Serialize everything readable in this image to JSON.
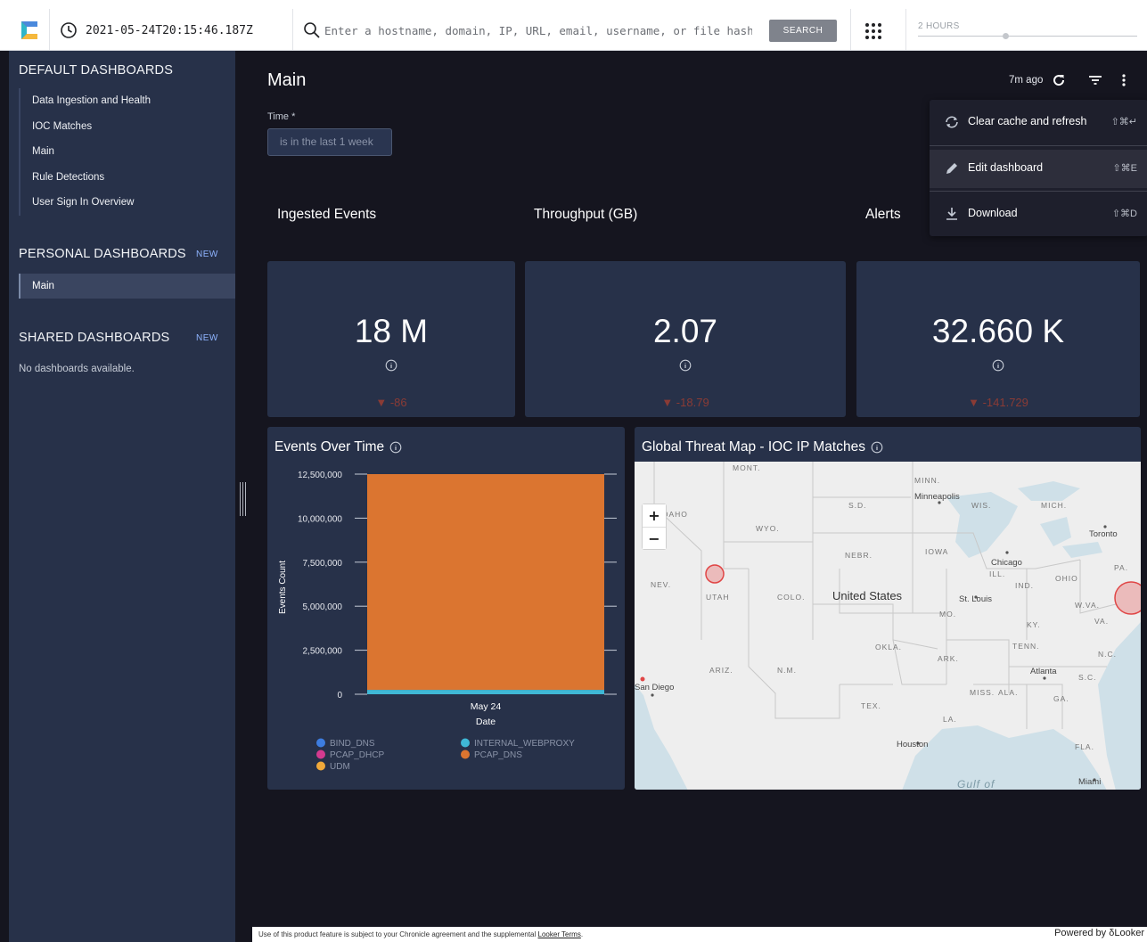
{
  "topbar": {
    "timestamp": "2021-05-24T20:15:46.187Z",
    "search_placeholder": "Enter a hostname, domain, IP, URL, email, username, or file hash",
    "search_button": "SEARCH",
    "time_range_label": "2 HOURS",
    "time_range_slider_fraction": 0.4
  },
  "sidebar": {
    "default_title": "DEFAULT DASHBOARDS",
    "default_items": [
      "Data Ingestion and Health",
      "IOC Matches",
      "Main",
      "Rule Detections",
      "User Sign In Overview"
    ],
    "personal_title": "PERSONAL DASHBOARDS",
    "personal_new": "NEW",
    "personal_items": [
      "Main"
    ],
    "shared_title": "SHARED DASHBOARDS",
    "shared_new": "NEW",
    "shared_empty": "No dashboards available."
  },
  "dashboard": {
    "title": "Main",
    "updated": "7m ago",
    "filter_label": "Time *",
    "filter_value": "is in the last 1 week"
  },
  "menu": {
    "items": [
      {
        "label": "Clear cache and refresh",
        "shortcut": "⇧⌘↵",
        "icon": "refresh-icon"
      },
      {
        "label": "Edit dashboard",
        "shortcut": "⇧⌘E",
        "icon": "pencil-icon"
      },
      {
        "label": "Download",
        "shortcut": "⇧⌘D",
        "icon": "download-icon"
      }
    ]
  },
  "tiles": [
    {
      "heading": "Ingested Events",
      "value": "18 M",
      "delta": "▼ -86"
    },
    {
      "heading": "Throughput (GB)",
      "value": "2.07",
      "delta": "▼ -18.79"
    },
    {
      "heading": "Alerts",
      "value": "32.660 K",
      "delta": "▼ -141.729"
    }
  ],
  "events_chart": {
    "title": "Events Over Time"
  },
  "map": {
    "title": "Global Threat Map - IOC IP Matches",
    "labels": [
      "MONT.",
      "MINN.",
      "Minneapolis",
      "WIS.",
      "MICH.",
      "IDAHO",
      "S.D.",
      "WYO.",
      "Toronto",
      "IOWA",
      "NEBR.",
      "Chicago",
      "PA.",
      "ILL.",
      "IND.",
      "OHIO",
      "NEV.",
      "UTAH",
      "COLO.",
      "United States",
      "St. Louis",
      "MO.",
      "W.VA.",
      "VA.",
      "KY.",
      "OKLA.",
      "TENN.",
      "N.C.",
      "ARK.",
      "ARIZ.",
      "N.M.",
      "Atlanta",
      "S.C.",
      "San Diego",
      "MISS.",
      "ALA.",
      "GA.",
      "TEX.",
      "LA.",
      "Houston",
      "FLA.",
      "Gulf of",
      "Miami"
    ]
  },
  "footer": {
    "text": "Use of this product feature is subject to your Chronicle agreement and the supplemental ",
    "link": "Looker Terms",
    "tail": ".",
    "powered": "Powered by",
    "brand": "Looker"
  },
  "chart_data": {
    "type": "area",
    "x": [
      "May 24"
    ],
    "xlabel": "Date",
    "ylabel": "Events Count",
    "ylim": [
      0,
      12500000
    ],
    "yticks": [
      0,
      2500000,
      5000000,
      7500000,
      10000000,
      12500000
    ],
    "ytick_labels": [
      "0",
      "2,500,000",
      "5,000,000",
      "7,500,000",
      "10,000,000",
      "12,500,000"
    ],
    "series": [
      {
        "name": "BIND_DNS",
        "values": [
          0
        ],
        "color": "#3d7de0"
      },
      {
        "name": "INTERNAL_WEBPROXY",
        "values": [
          250000
        ],
        "color": "#3fb8d6"
      },
      {
        "name": "PCAP_DHCP",
        "values": [
          0
        ],
        "color": "#d43a8f"
      },
      {
        "name": "PCAP_DNS",
        "values": [
          12250000
        ],
        "color": "#db7530"
      },
      {
        "name": "UDM",
        "values": [
          0
        ],
        "color": "#f0a93a"
      }
    ],
    "legend": "bottom"
  }
}
